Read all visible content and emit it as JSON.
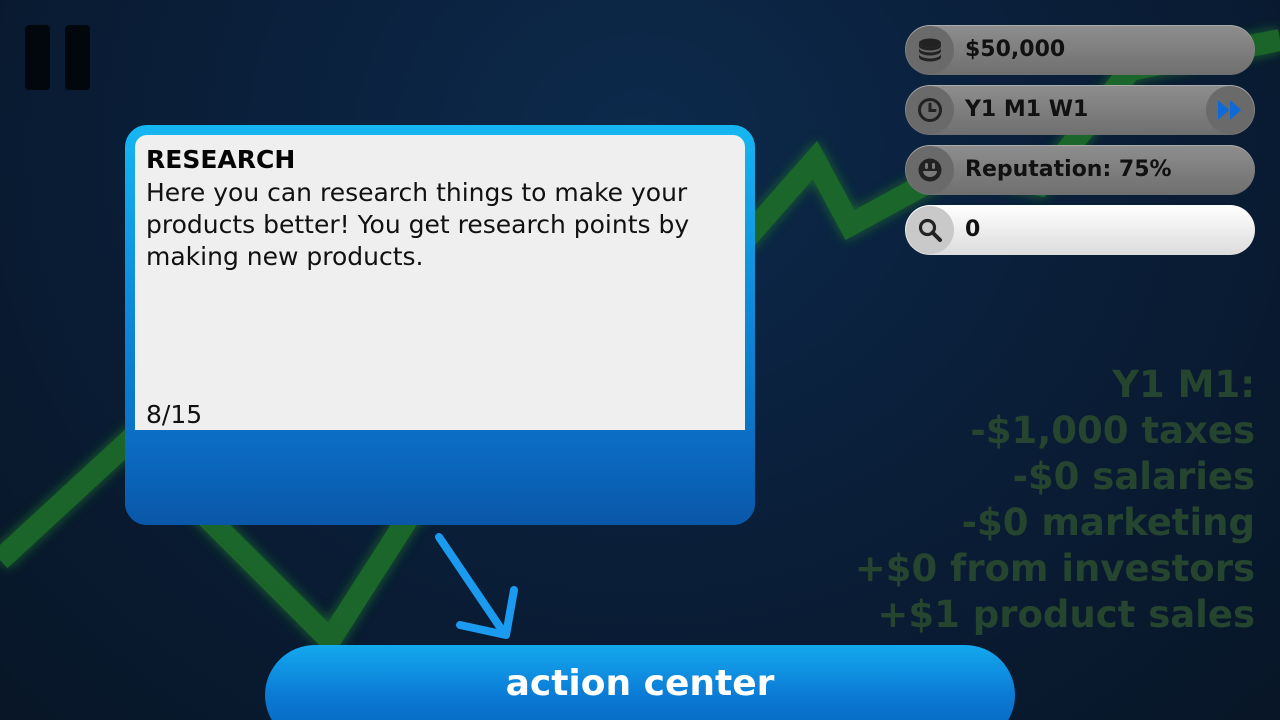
{
  "hud": {
    "money": "$50,000",
    "date": "Y1 M1 W1",
    "reputation": "Reputation: 75%",
    "research_points": "0"
  },
  "tutorial": {
    "title": "RESEARCH",
    "text": "Here you can research things to make your products better! You get research points by making new products.",
    "progress": "8/15"
  },
  "action_button": {
    "label": "action center"
  },
  "monthly_report": {
    "lines": [
      "Y1 M1:",
      "-$1,000 taxes",
      "-$0 salaries",
      "-$0 marketing",
      "+$0 from investors",
      "+$1 product sales"
    ]
  },
  "icons": {
    "pause": "pause-icon",
    "money": "coins-icon",
    "date": "clock-icon",
    "fast_forward": "fast-forward-icon",
    "reputation": "smiley-icon",
    "research": "magnifier-icon",
    "pointer": "arrow-down-right-icon"
  },
  "colors": {
    "accent_blue": "#0e8ad8",
    "graph_green": "#1f6b2a",
    "summary_text": "#25452f"
  }
}
